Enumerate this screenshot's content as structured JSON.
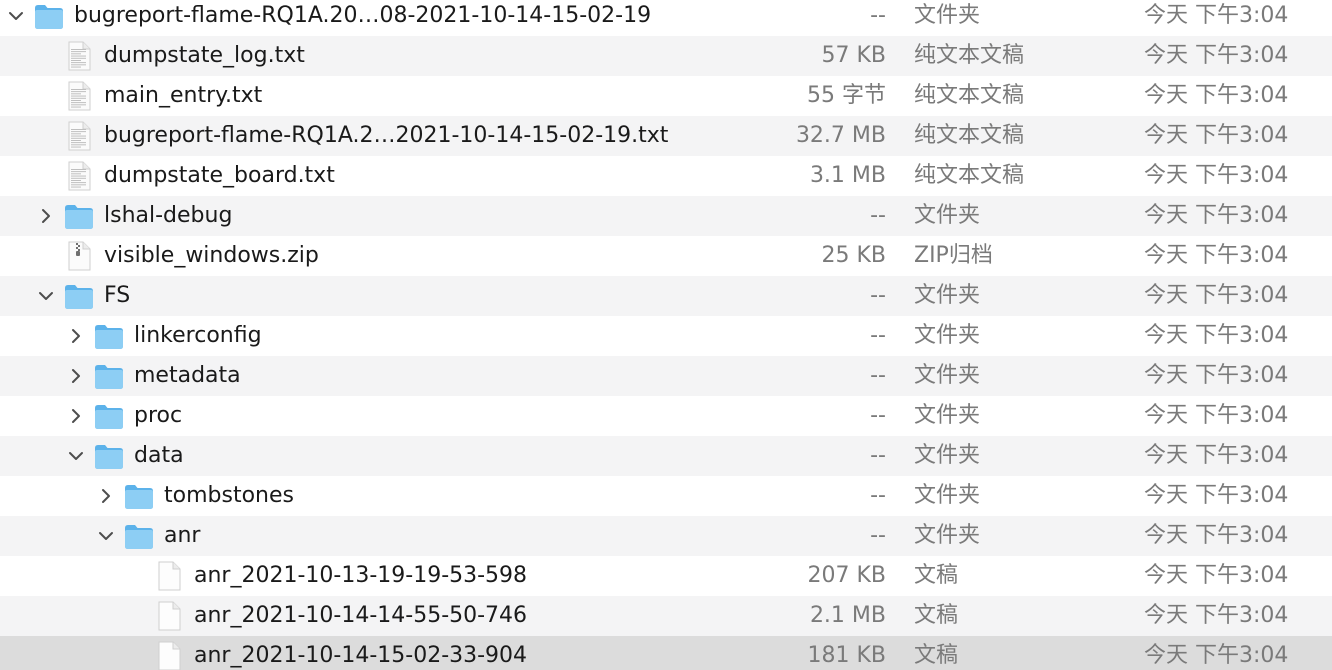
{
  "colors": {
    "folder_light": "#8dcef4",
    "folder_dark": "#5cb2ea",
    "row_alt": "#f4f4f5",
    "row_selected": "#dcdcdc",
    "text_primary": "#1a1a1a",
    "text_secondary": "#7a7a7a"
  },
  "files": [
    {
      "name": "bugreport-flame-RQ1A.20…08-2021-10-14-15-02-19",
      "size": "--",
      "kind": "文件夹",
      "date": "今天 下午3:04",
      "icon": "folder-icon",
      "depth": 0,
      "expander": "expanded",
      "selected": false
    },
    {
      "name": "dumpstate_log.txt",
      "size": "57 KB",
      "kind": "纯文本文稿",
      "date": "今天 下午3:04",
      "icon": "text-document-icon",
      "depth": 1,
      "expander": "none",
      "selected": false
    },
    {
      "name": "main_entry.txt",
      "size": "55 字节",
      "kind": "纯文本文稿",
      "date": "今天 下午3:04",
      "icon": "text-document-icon",
      "depth": 1,
      "expander": "none",
      "selected": false
    },
    {
      "name": "bugreport-flame-RQ1A.2…2021-10-14-15-02-19.txt",
      "size": "32.7 MB",
      "kind": "纯文本文稿",
      "date": "今天 下午3:04",
      "icon": "text-document-icon",
      "depth": 1,
      "expander": "none",
      "selected": false
    },
    {
      "name": "dumpstate_board.txt",
      "size": "3.1 MB",
      "kind": "纯文本文稿",
      "date": "今天 下午3:04",
      "icon": "text-document-icon",
      "depth": 1,
      "expander": "none",
      "selected": false
    },
    {
      "name": "lshal-debug",
      "size": "--",
      "kind": "文件夹",
      "date": "今天 下午3:04",
      "icon": "folder-icon",
      "depth": 1,
      "expander": "collapsed",
      "selected": false
    },
    {
      "name": "visible_windows.zip",
      "size": "25 KB",
      "kind": "ZIP归档",
      "date": "今天 下午3:04",
      "icon": "zip-archive-icon",
      "depth": 1,
      "expander": "none",
      "selected": false
    },
    {
      "name": "FS",
      "size": "--",
      "kind": "文件夹",
      "date": "今天 下午3:04",
      "icon": "folder-icon",
      "depth": 1,
      "expander": "expanded",
      "selected": false
    },
    {
      "name": "linkerconfig",
      "size": "--",
      "kind": "文件夹",
      "date": "今天 下午3:04",
      "icon": "folder-icon",
      "depth": 2,
      "expander": "collapsed",
      "selected": false
    },
    {
      "name": "metadata",
      "size": "--",
      "kind": "文件夹",
      "date": "今天 下午3:04",
      "icon": "folder-icon",
      "depth": 2,
      "expander": "collapsed",
      "selected": false
    },
    {
      "name": "proc",
      "size": "--",
      "kind": "文件夹",
      "date": "今天 下午3:04",
      "icon": "folder-icon",
      "depth": 2,
      "expander": "collapsed",
      "selected": false
    },
    {
      "name": "data",
      "size": "--",
      "kind": "文件夹",
      "date": "今天 下午3:04",
      "icon": "folder-icon",
      "depth": 2,
      "expander": "expanded",
      "selected": false
    },
    {
      "name": "tombstones",
      "size": "--",
      "kind": "文件夹",
      "date": "今天 下午3:04",
      "icon": "folder-icon",
      "depth": 3,
      "expander": "collapsed",
      "selected": false
    },
    {
      "name": "anr",
      "size": "--",
      "kind": "文件夹",
      "date": "今天 下午3:04",
      "icon": "folder-icon",
      "depth": 3,
      "expander": "expanded",
      "selected": false
    },
    {
      "name": "anr_2021-10-13-19-19-53-598",
      "size": "207 KB",
      "kind": "文稿",
      "date": "今天 下午3:04",
      "icon": "blank-document-icon",
      "depth": 4,
      "expander": "none",
      "selected": false
    },
    {
      "name": "anr_2021-10-14-14-55-50-746",
      "size": "2.1 MB",
      "kind": "文稿",
      "date": "今天 下午3:04",
      "icon": "blank-document-icon",
      "depth": 4,
      "expander": "none",
      "selected": false
    },
    {
      "name": "anr_2021-10-14-15-02-33-904",
      "size": "181 KB",
      "kind": "文稿",
      "date": "今天 下午3:04",
      "icon": "blank-document-icon",
      "depth": 4,
      "expander": "none",
      "selected": true
    }
  ]
}
